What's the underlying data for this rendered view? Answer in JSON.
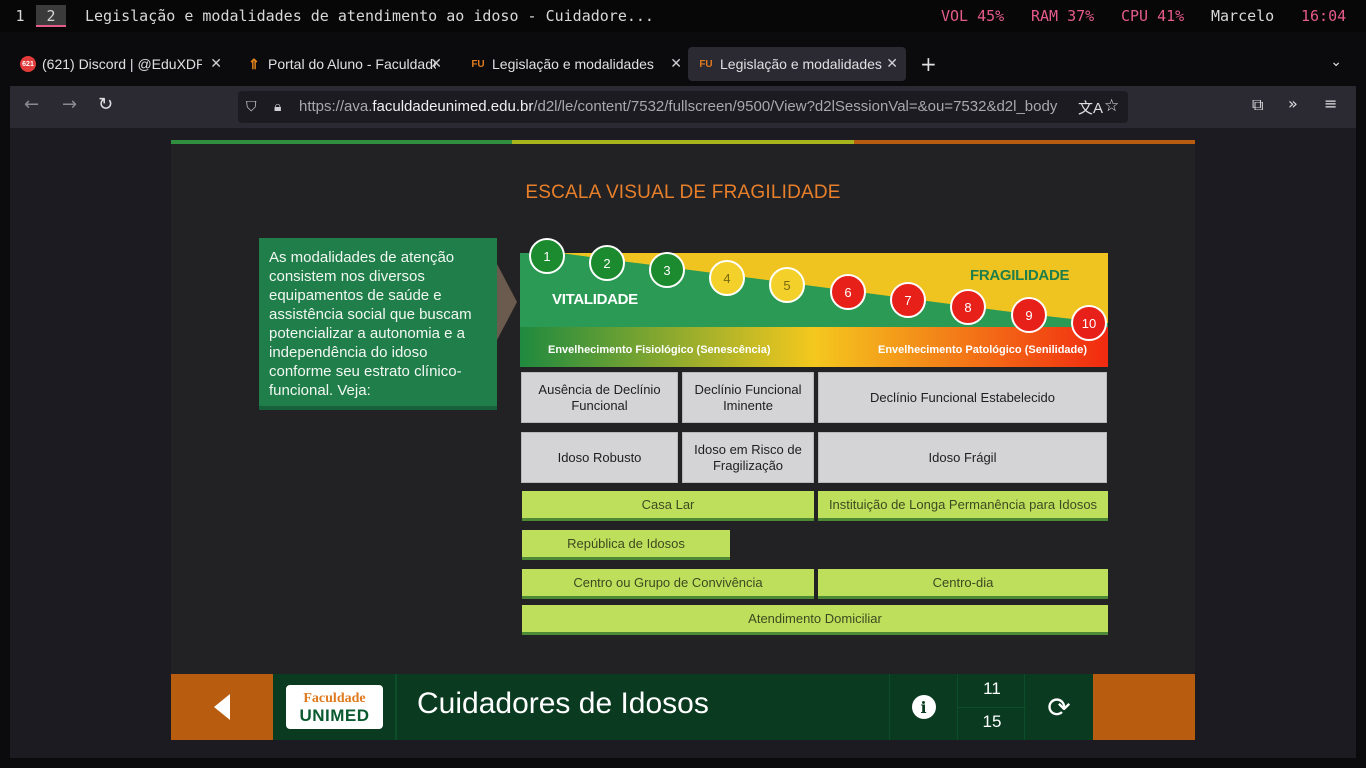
{
  "wm": {
    "workspace1": "1",
    "workspace2": "2",
    "window_title": "Legislação e modalidades de atendimento ao idoso - Cuidadore...",
    "vol": "VOL 45%",
    "ram": "RAM 37%",
    "cpu": "CPU 41%",
    "user": "Marcelo",
    "time": "16:04"
  },
  "tabs": [
    {
      "label": "(621) Discord | @EduXDP",
      "icon_text": "621",
      "icon": "discord-icon"
    },
    {
      "label": "Portal do Aluno - Faculdade",
      "icon": "portal-icon"
    },
    {
      "label": "Legislação e modalidades de",
      "icon_text": "FU",
      "icon": "fu-icon"
    },
    {
      "label": "Legislação e modalidades de",
      "icon_text": "FU",
      "icon": "fu-icon",
      "active": true
    }
  ],
  "url": {
    "prefix": "https://ava.",
    "domain": "faculdadeunimed.edu.br",
    "path": "/d2l/le/content/7532/fullscreen/9500/View?d2lSessionVal=&ou=7532&d2l_body"
  },
  "slide": {
    "title": "ESCALA VISUAL DE FRAGILIDADE",
    "intro": "As modalidades de atenção consistem nos diversos equipamentos de saúde e assistência social que buscam potencializar a autonomia e a independência do idoso conforme seu estrato clínico-funcional. Veja:",
    "vitality": "VITALIDADE",
    "fragility": "FRAGILIDADE",
    "physio": "Envelhecimento Fisiológico (Senescência)",
    "patho": "Envelhecimento Patológico (Senilidade)",
    "scale": [
      "1",
      "2",
      "3",
      "4",
      "5",
      "6",
      "7",
      "8",
      "9",
      "10"
    ],
    "decline_row": [
      "Ausência de Declínio Funcional",
      "Declínio Funcional Iminente",
      "Declínio Funcional Estabelecido"
    ],
    "status_row": [
      "Idoso Robusto",
      "Idoso em Risco de Fragilização",
      "Idoso Frágil"
    ],
    "services": {
      "casa_lar": "Casa Lar",
      "ilpi": "Instituição de Longa Permanência para Idosos",
      "republica": "República de Idosos",
      "convivencia": "Centro ou Grupo de Convivência",
      "centro_dia": "Centro-dia",
      "domiciliar": "Atendimento Domiciliar"
    },
    "colors": {
      "green": "#1f7e4a",
      "orange": "#e87f2a",
      "stripe": [
        "#2f8f3f",
        "#a8b41c",
        "#b85c0f"
      ]
    }
  },
  "footer": {
    "logo_top": "Faculdade",
    "logo_bottom": "UNIMED",
    "course": "Cuidadores de Idosos",
    "page_current": "11",
    "page_total": "15"
  }
}
